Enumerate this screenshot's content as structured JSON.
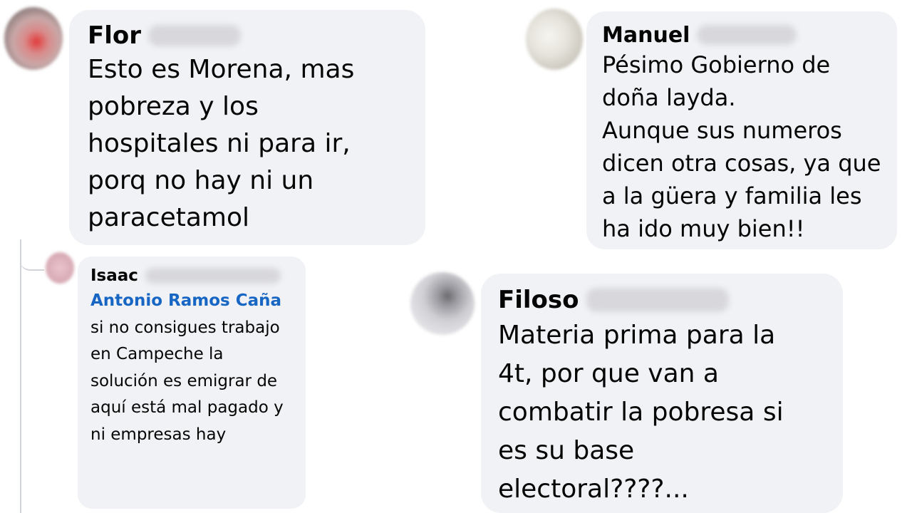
{
  "comments": [
    {
      "id": "flor",
      "author": "Flor",
      "text": "Esto es Morena, mas pobreza y los hospitales ni para ir, porq no hay ni un paracetamol"
    },
    {
      "id": "manuel",
      "author": "Manuel",
      "text_lines": [
        "Pésimo Gobierno de doña layda.",
        "Aunque sus numeros dicen otra cosas, ya que a la güera y familia les ha ido muy bien!!"
      ]
    },
    {
      "id": "isaac",
      "author": "Isaac",
      "mention": "Antonio Ramos Caña",
      "text": "si no consigues trabajo en Campeche la solución es emigrar de aquí está mal pagado y ni empresas hay"
    },
    {
      "id": "filoso",
      "author": "Filoso",
      "text": "Materia prima para la 4t, por que van a combatir la pobresa si es su base electoral????..."
    }
  ],
  "colors": {
    "bubble": "#f0f2f5",
    "mention": "#1766c4",
    "text": "#050505"
  }
}
